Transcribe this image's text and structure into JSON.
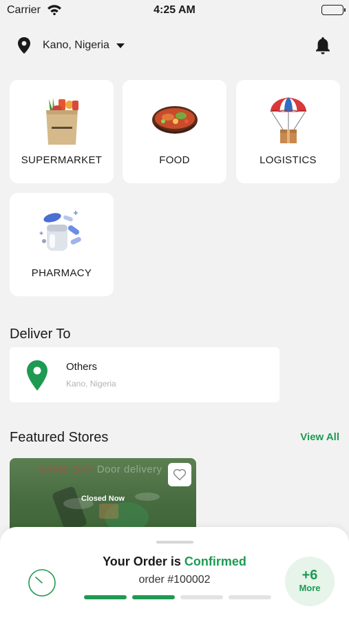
{
  "status_bar": {
    "carrier": "Carrier",
    "time": "4:25 AM"
  },
  "header": {
    "location": "Kano, Nigeria"
  },
  "categories": [
    {
      "label": "SUPERMARKET",
      "icon": "grocery-bag-icon"
    },
    {
      "label": "FOOD",
      "icon": "food-bowl-icon"
    },
    {
      "label": "LOGISTICS",
      "icon": "parachute-box-icon"
    },
    {
      "label": "PHARMACY",
      "icon": "pills-jar-icon"
    }
  ],
  "deliver": {
    "title": "Deliver To",
    "name": "Others",
    "address": "Kano, Nigeria"
  },
  "featured": {
    "title": "Featured Stores",
    "view_all": "View All",
    "store": {
      "banner_red": "SAME DAY",
      "banner_rest": "Door delivery",
      "status": "Closed Now"
    }
  },
  "order": {
    "prefix": "Your Order is",
    "status": "Confirmed",
    "number": "order #100002",
    "steps_total": 4,
    "steps_done": 2,
    "more_count": "+6",
    "more_label": "More"
  },
  "colors": {
    "accent": "#1e9a52",
    "background": "#f2f2f2"
  }
}
